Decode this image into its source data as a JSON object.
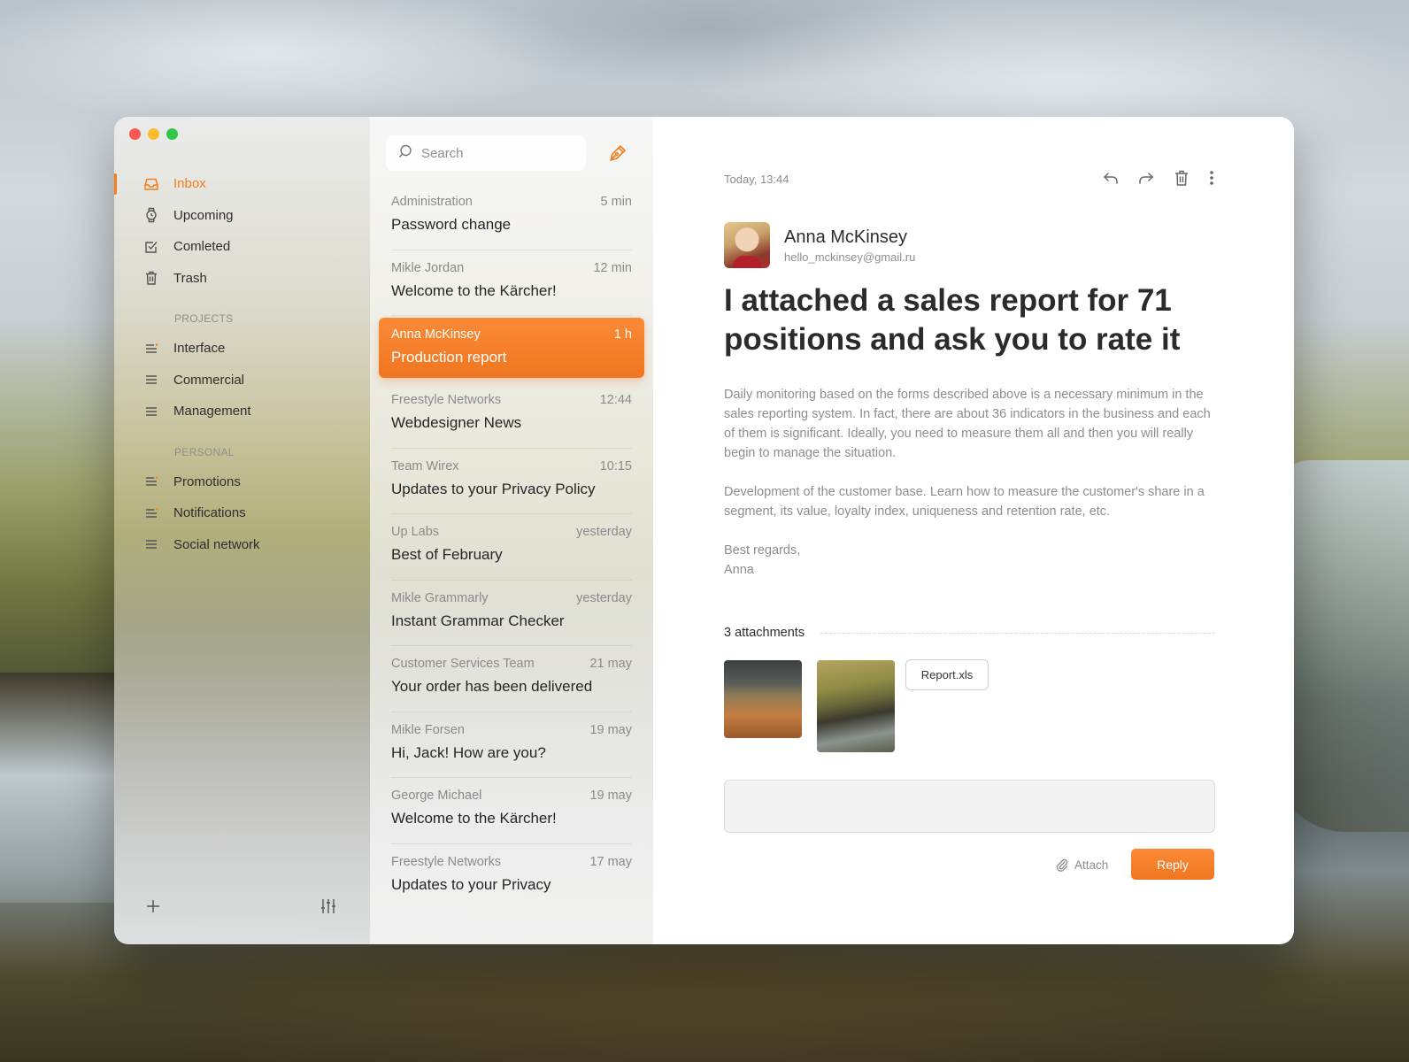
{
  "sidebar": {
    "nav": [
      {
        "label": "Inbox",
        "icon": "inbox-icon",
        "active": true
      },
      {
        "label": "Upcoming",
        "icon": "watch-icon"
      },
      {
        "label": "Comleted",
        "icon": "checkbox-icon"
      },
      {
        "label": "Trash",
        "icon": "trash-icon"
      }
    ],
    "projects_title": "PROJECTS",
    "projects": [
      {
        "label": "Interface",
        "icon": "list-icon",
        "unread_dot": true
      },
      {
        "label": "Commercial",
        "icon": "list-icon"
      },
      {
        "label": "Management",
        "icon": "list-icon"
      }
    ],
    "personal_title": "PERSONAL",
    "personal": [
      {
        "label": "Promotions",
        "icon": "list-icon",
        "unread_dot": true
      },
      {
        "label": "Notifications",
        "icon": "list-icon",
        "unread_dot": true
      },
      {
        "label": "Social network",
        "icon": "list-icon"
      }
    ],
    "footer": {
      "add_icon": "plus-icon",
      "settings_icon": "sliders-icon"
    }
  },
  "list": {
    "search": {
      "placeholder": "Search",
      "icon": "search-icon"
    },
    "compose_icon": "pen-icon",
    "items": [
      {
        "from": "Administration",
        "time": "5 min",
        "subject": "Password change"
      },
      {
        "from": "Mikle Jordan",
        "time": "12 min",
        "subject": "Welcome to the Kärcher!"
      },
      {
        "from": "Anna McKinsey",
        "time": "1 h",
        "subject": "Production report",
        "selected": true
      },
      {
        "from": "Freestyle Networks",
        "time": "12:44",
        "subject": "Webdesigner News"
      },
      {
        "from": "Team Wirex",
        "time": "10:15",
        "subject": "Updates to your Privacy Policy"
      },
      {
        "from": "Up Labs",
        "time": "yesterday",
        "subject": "Best of February"
      },
      {
        "from": "Mikle Grammarly",
        "time": "yesterday",
        "subject": "Instant Grammar Checker"
      },
      {
        "from": "Customer Services Team",
        "time": "21 may",
        "subject": "Your order has been delivered"
      },
      {
        "from": "Mikle Forsen",
        "time": "19 may",
        "subject": "Hi, Jack! How are you?"
      },
      {
        "from": "George Michael",
        "time": "19 may",
        "subject": "Welcome to the Kärcher!"
      },
      {
        "from": "Freestyle Networks",
        "time": "17 may",
        "subject": "Updates to your Privacy"
      }
    ]
  },
  "reader": {
    "date": "Today, 13:44",
    "actions": [
      "reply-icon",
      "forward-icon",
      "trash-icon",
      "more-icon"
    ],
    "sender_name": "Anna McKinsey",
    "sender_email": "hello_mckinsey@gmail.ru",
    "headline": "I attached a sales report for 71 positions and ask you to rate it",
    "paragraphs": [
      "Daily monitoring based on the forms described above is a necessary minimum in the sales reporting system. In fact, there are about 36 indicators in the business and each of them is significant. Ideally, you need to measure them all and then you will really begin to manage the situation.",
      "Development of the customer base. Learn how to measure the customer's share in a segment, its value, loyalty index, uniqueness and retention rate, etc."
    ],
    "signoff_line1": "Best regards,",
    "signoff_line2": "Anna",
    "attachments_title": "3 attachments",
    "file_name": "Report.xls",
    "reply_placeholder": "",
    "attach_label": "Attach",
    "reply_label": "Reply"
  },
  "colors": {
    "accent": "#f07d1e",
    "text": "#2b2b2b",
    "muted": "#8e8e8e"
  }
}
